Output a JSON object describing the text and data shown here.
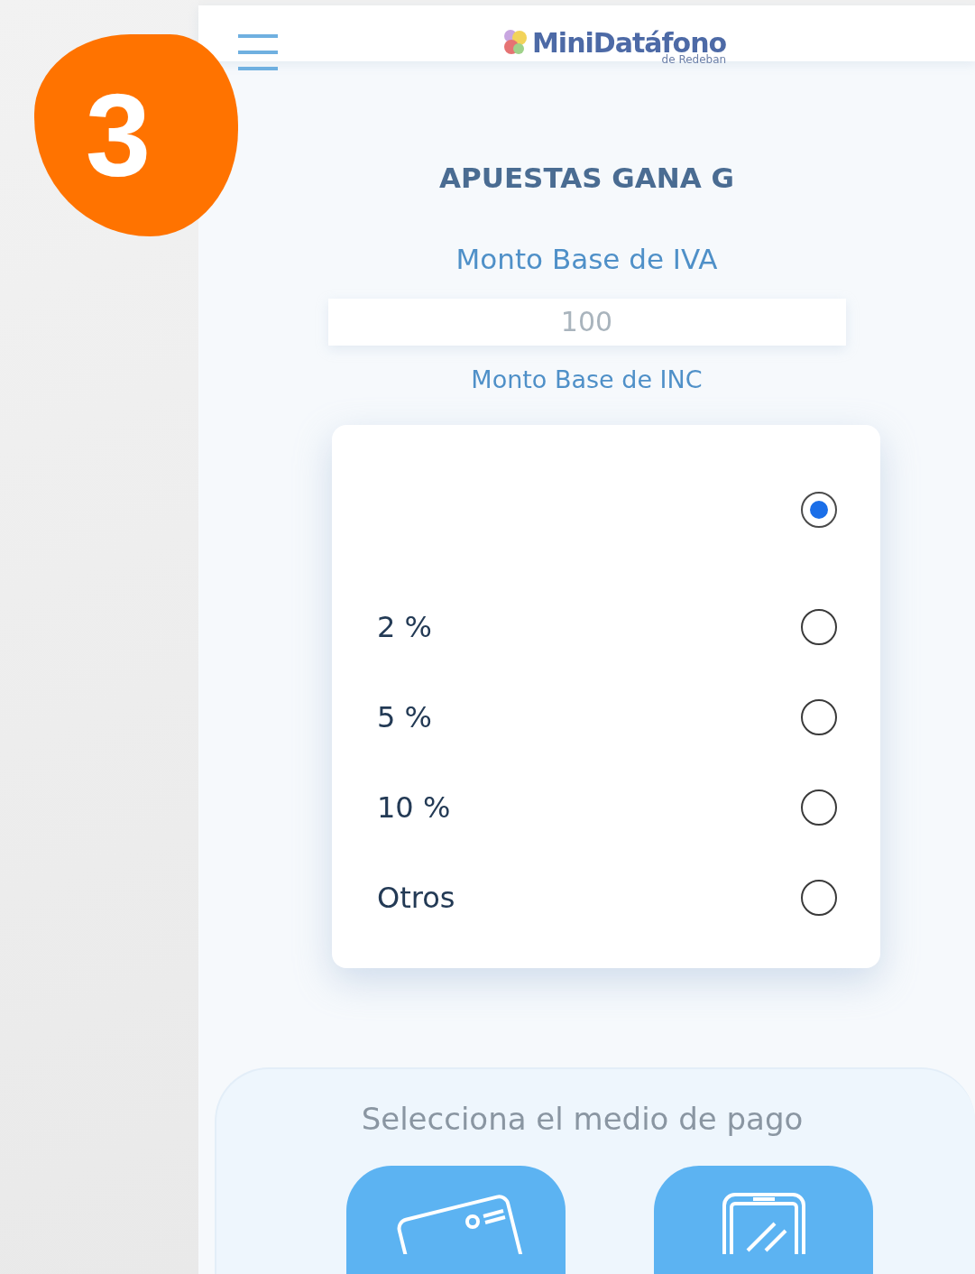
{
  "step_badge": "3",
  "app_bar": {
    "logo_text": "MiniDatáfono",
    "logo_subtext": "de Redeban"
  },
  "merchant_name": "APUESTAS GANA G",
  "iva_field": {
    "label": "Monto Base de IVA",
    "value": "100"
  },
  "inc_label": "Monto Base de INC",
  "inc_options": [
    {
      "selected": true
    },
    {
      "label": "2 %",
      "selected": false
    },
    {
      "label": "5 %",
      "selected": false
    },
    {
      "label": "10 %",
      "selected": false
    },
    {
      "label": "Otros",
      "selected": false
    }
  ],
  "payment": {
    "title": "Selecciona el medio de pago",
    "methods": [
      {
        "kind": "card"
      },
      {
        "kind": "phone"
      }
    ]
  }
}
